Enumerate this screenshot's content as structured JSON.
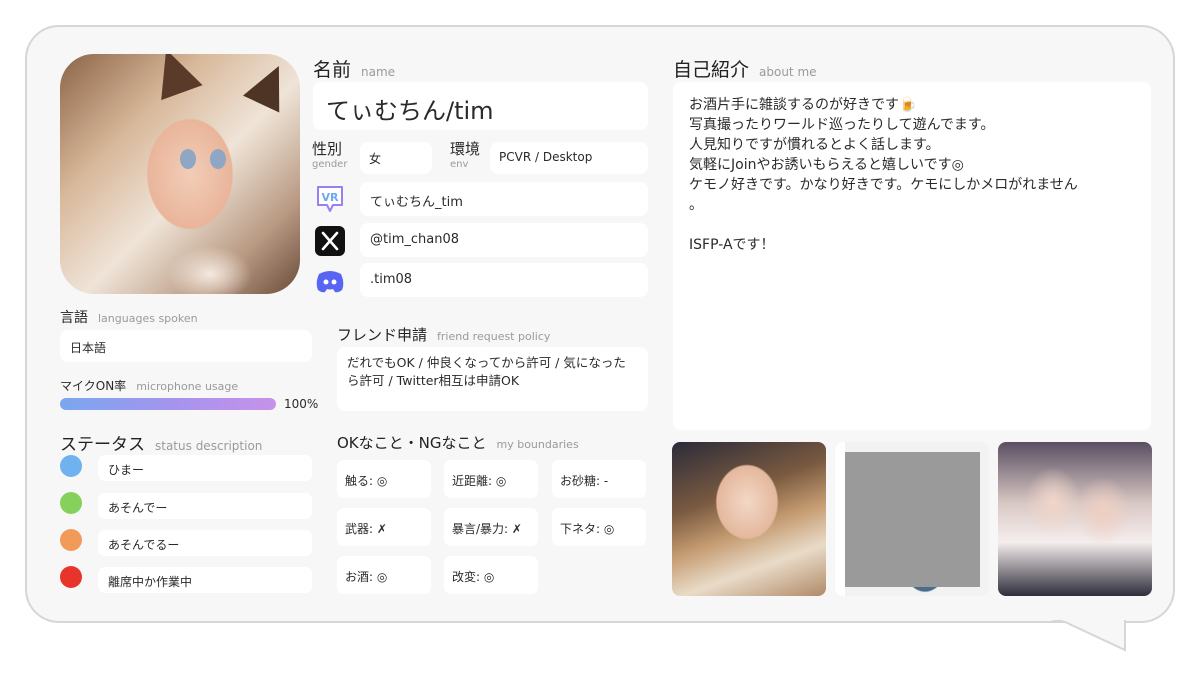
{
  "name": {
    "label": "名前",
    "sub": "name",
    "value": "てぃむちん/tim"
  },
  "gender": {
    "label": "性別",
    "sub": "gender",
    "value": "女"
  },
  "env": {
    "label": "環境",
    "sub": "env",
    "value": "PCVR / Desktop"
  },
  "accounts": [
    {
      "icon": "vrchat-icon",
      "value": "てぃむちん_tim"
    },
    {
      "icon": "x-icon",
      "value": "@tim_chan08"
    },
    {
      "icon": "discord-icon",
      "value": ".tim08"
    }
  ],
  "languages": {
    "label": "言語",
    "sub": "languages spoken",
    "value": "日本語"
  },
  "mic": {
    "label": "マイクON率",
    "sub": "microphone usage",
    "percent_text": "100%",
    "fraction": 1.0
  },
  "status": {
    "label": "ステータス",
    "sub": "status description",
    "items": [
      {
        "color": "#6fb2ef",
        "label": "ひまー"
      },
      {
        "color": "#86d15b",
        "label": "あそんでー"
      },
      {
        "color": "#f29a5a",
        "label": "あそんでるー"
      },
      {
        "color": "#e8352c",
        "label": "離席中か作業中"
      }
    ]
  },
  "friend": {
    "label": "フレンド申請",
    "sub": "friend request policy",
    "value": "だれでもOK / 仲良くなってから許可 / 気になったら許可 / Twitter相互は申請OK"
  },
  "boundaries": {
    "label": "OKなこと・NGなこと",
    "sub": "my boundaries",
    "items": [
      "触る: ◎",
      "近距離: ◎",
      "お砂糖: -",
      "武器: ✗",
      "暴言/暴力: ✗",
      "下ネタ: ◎",
      "お酒: ◎",
      "改変: ◎"
    ]
  },
  "about": {
    "label": "自己紹介",
    "sub": "about me",
    "text": "お酒片手に雑談するのが好きです🍺\n写真撮ったりワールド巡ったりして遊んでます。\n人見知りですが慣れるとよく話します。\n気軽にJoinやお誘いもらえると嬉しいです◎\nケモノ好きです。かなり好きです。ケモにしかメロがれません\n。\n\nISFP-Aです！"
  }
}
